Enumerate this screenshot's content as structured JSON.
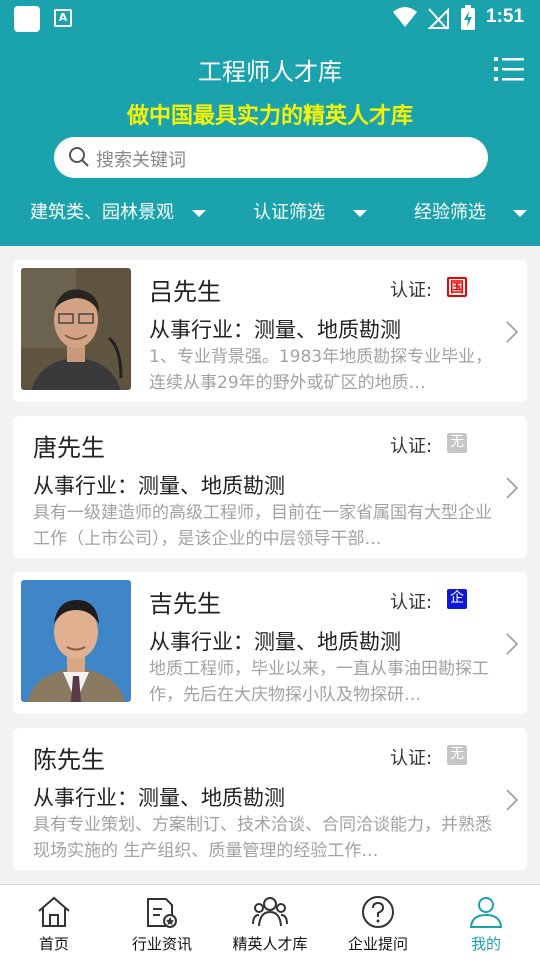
{
  "status_bar": {
    "time": "1:51"
  },
  "header": {
    "title": "工程师人才库",
    "slogan": "做中国最具实力的精英人才库",
    "search_placeholder": "搜索关键词"
  },
  "filters": [
    {
      "label": "建筑类、园林景观"
    },
    {
      "label": "认证筛选"
    },
    {
      "label": "经验筛选"
    }
  ],
  "cards": [
    {
      "name": "吕先生",
      "cert_label": "认证:",
      "badge": "国",
      "industry": "从事行业：测量、地质勘测",
      "desc": "1、专业背景强。1983年地质勘探专业毕业，连续从事29年的野外或矿区的地质…",
      "has_photo": true
    },
    {
      "name": "唐先生",
      "cert_label": "认证:",
      "badge": "无",
      "industry": "从事行业：测量、地质勘测",
      "desc": "具有一级建造师的高级工程师，目前在一家省属国有大型企业工作（上市公司），是该企业的中层领导干部…",
      "has_photo": false
    },
    {
      "name": "吉先生",
      "cert_label": "认证:",
      "badge": "企",
      "industry": "从事行业：测量、地质勘测",
      "desc": "地质工程师，毕业以来，一直从事油田勘探工作，先后在大庆物探小队及物探研…",
      "has_photo": true
    },
    {
      "name": "陈先生",
      "cert_label": "认证:",
      "badge": "无",
      "industry": "从事行业：测量、地质勘测",
      "desc": "具有专业策划、方案制订、技术洽谈、合同洽谈能力，并熟悉现场实施的 生产组织、质量管理的经验工作…",
      "has_photo": false
    }
  ],
  "tabs": [
    {
      "label": "首页",
      "icon": "home-icon"
    },
    {
      "label": "行业资讯",
      "icon": "news-icon"
    },
    {
      "label": "精英人才库",
      "icon": "talent-icon"
    },
    {
      "label": "企业提问",
      "icon": "question-icon"
    },
    {
      "label": "我的",
      "icon": "profile-icon",
      "active": true
    }
  ],
  "colors": {
    "primary": "#1aa3ad",
    "slogan": "#f5f20a",
    "badge_national": "#e00000",
    "badge_enterprise": "#0f18d6",
    "badge_none": "#c6c6c6"
  }
}
